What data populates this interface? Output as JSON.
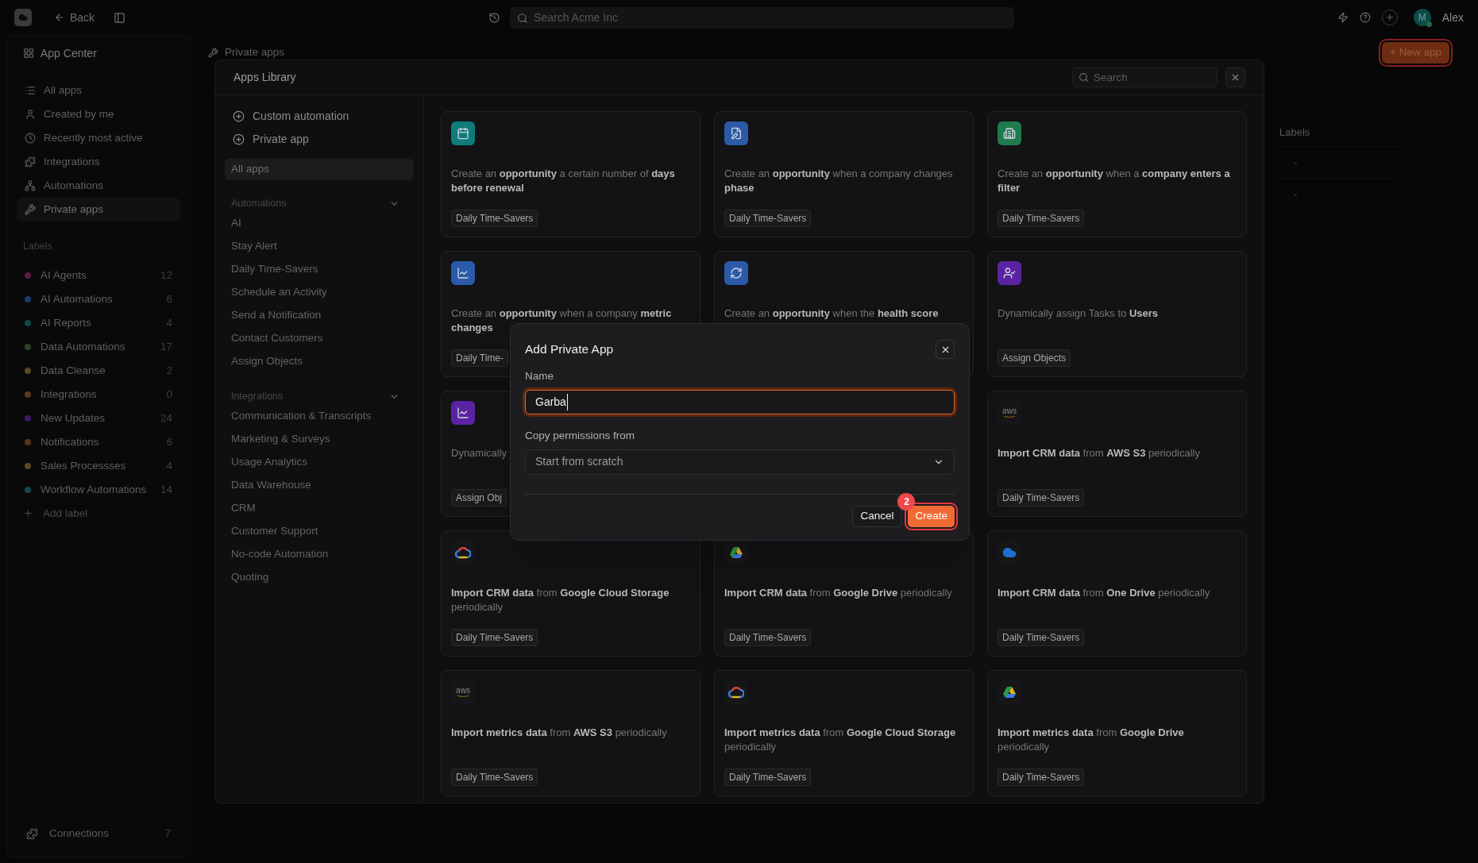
{
  "topbar": {
    "back": "Back",
    "search": {
      "placeholder": "Search Acme Inc"
    },
    "user": {
      "initial": "M",
      "name": "Alex",
      "online": true
    }
  },
  "sidebar": {
    "title": "App Center",
    "items": [
      {
        "label": "All apps",
        "selected": false
      },
      {
        "label": "Created by me",
        "selected": false
      },
      {
        "label": "Recently most active",
        "selected": false
      },
      {
        "label": "Integrations",
        "selected": false
      },
      {
        "label": "Automations",
        "selected": false
      },
      {
        "label": "Private apps",
        "selected": true
      }
    ],
    "labels_heading": "Labels",
    "labels": [
      {
        "name": "AI Agents",
        "count": "12",
        "color": "#5c1d4b"
      },
      {
        "name": "AI Automations",
        "count": "6",
        "color": "#1f3a6a"
      },
      {
        "name": "AI Reports",
        "count": "4",
        "color": "#12494a"
      },
      {
        "name": "Data Automations",
        "count": "17",
        "color": "#2b4724"
      },
      {
        "name": "Data Cleanse",
        "count": "2",
        "color": "#5a4a1f"
      },
      {
        "name": "Integrations",
        "count": "0",
        "color": "#5c3a19"
      },
      {
        "name": "New Updates",
        "count": "24",
        "color": "#3c1b62"
      },
      {
        "name": "Notifications",
        "count": "6",
        "color": "#5a3419"
      },
      {
        "name": "Sales Processses",
        "count": "4",
        "color": "#5a4a1f"
      },
      {
        "name": "Workflow Automations",
        "count": "14",
        "color": "#12494a"
      }
    ],
    "add_label": "Add label",
    "connections": {
      "label": "Connections",
      "count": "7"
    }
  },
  "page": {
    "breadcrumb": "Private apps",
    "new_app_button": {
      "label": "+ New app",
      "highlighted": true
    },
    "table": {
      "columns": [
        "Labels"
      ],
      "rows": [
        [
          "-"
        ],
        [
          "-"
        ]
      ]
    }
  },
  "library": {
    "title": "Apps Library",
    "search": {
      "placeholder": "Search"
    },
    "actions": [
      "Custom automation",
      "Private app"
    ],
    "all_apps": {
      "label": "All apps",
      "selected": true
    },
    "sections": [
      {
        "title": "Automations",
        "expanded": true,
        "items": [
          "AI",
          "Stay Alert",
          "Daily Time-Savers",
          "Schedule an Activity",
          "Send a Notification",
          "Contact Customers",
          "Assign Objects"
        ]
      },
      {
        "title": "Integrations",
        "expanded": true,
        "items": [
          "Communication & Transcripts",
          "Marketing & Surveys",
          "Usage Analytics",
          "Data Warehouse",
          "CRM",
          "Customer Support",
          "No-code Automation",
          "Quoting"
        ]
      }
    ],
    "cards": [
      {
        "color": "#0f7c7a",
        "text": "Create an **opportunity** a certain number of **days before renewal**",
        "tag": "Daily Time-Savers"
      },
      {
        "color": "#2b5aa8",
        "text": "Create an **opportunity** when a company changes **phase**",
        "tag": "Daily Time-Savers"
      },
      {
        "color": "#1f7a4d",
        "text": "Create an **opportunity** when a **company enters a filter**",
        "tag": "Daily Time-Savers"
      },
      {
        "color": "#2b5aa8",
        "text": "Create an **opportunity** when a company **metric changes**",
        "tag": "Daily Time-"
      },
      {
        "color": "#2b5aa8",
        "text": "Create an **opportunity** when the **health score**"
      },
      {
        "color": "#5b23a3",
        "text": "Dynamically assign Tasks to **Users**",
        "tag": "Assign Objects"
      },
      {
        "color": "#5b23a3",
        "text": "Dynamically",
        "tag": "Assign Obj"
      },
      {
        "logo": "aws",
        "text": "**Import CRM data** from **AWS S3** periodically",
        "tag": "Daily Time-Savers"
      },
      {
        "text": "**Import CRM data** from **Google Cloud Storage** periodically",
        "tag": "Daily Time-Savers"
      },
      {
        "text": "**Import CRM data** from **Google Drive** periodically",
        "tag": "Daily Time-Savers"
      },
      {
        "text": "**Import CRM data** from **One Drive** periodically",
        "tag": "Daily Time-Savers"
      },
      {
        "logo": "aws",
        "text": "**Import metrics data** from **AWS S3** periodically",
        "tag": "Daily Time-Savers"
      },
      {
        "text": "**Import metrics data** from **Google Cloud Storage** periodically",
        "tag": "Daily Time-Savers"
      },
      {
        "text": "**Import metrics data** from **Google Drive** periodically",
        "tag": "Daily Time-Savers"
      }
    ]
  },
  "dialog": {
    "title": "Add Private App",
    "name_label": "Name",
    "name_field": {
      "value": "Garba",
      "focused": true
    },
    "permissions_label": "Copy permissions from",
    "permissions_select": {
      "value": "Start from scratch"
    },
    "cancel": "Cancel",
    "create": {
      "label": "Create",
      "highlighted": true,
      "badge": "2"
    }
  }
}
